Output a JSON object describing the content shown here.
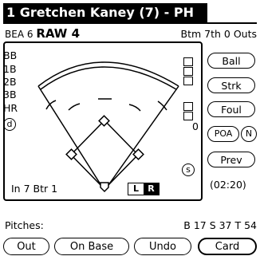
{
  "header": {
    "title": "1 Gretchen Kaney (7) - PH"
  },
  "score": {
    "team1": "BEA 6",
    "team2": "RAW 4",
    "status": "Btm 7th 0 Outs"
  },
  "stats": {
    "labels": [
      "BB",
      "1B",
      "2B",
      "3B",
      "HR"
    ],
    "d_label": "d",
    "s_label": "s",
    "runs": "0"
  },
  "situation": {
    "inning_batter": "In 7 Btr 1",
    "hand_left": "L",
    "hand_right": "R",
    "selected_hand": "R"
  },
  "side_buttons": {
    "ball": "Ball",
    "strike": "Strk",
    "foul": "Foul",
    "poa": "POA",
    "n": "N",
    "prev": "Prev"
  },
  "timer": "(02:20)",
  "pitches": {
    "label": "Pitches:",
    "counts": "B 17 S 37 T 54"
  },
  "bottom_buttons": {
    "out": "Out",
    "on_base": "On Base",
    "undo": "Undo",
    "card": "Card"
  }
}
